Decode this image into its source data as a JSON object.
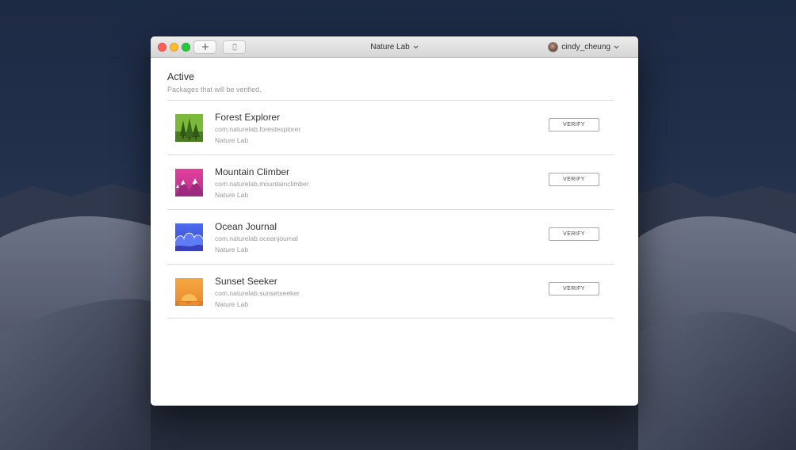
{
  "window": {
    "project": "Nature Lab",
    "user": "cindy_cheung"
  },
  "section": {
    "title": "Active",
    "subtitle": "Packages that will be verified."
  },
  "packages": [
    {
      "name": "Forest Explorer",
      "bundle_id": "com.naturelab.forestexplorer",
      "org": "Nature Lab",
      "action": "VERIFY",
      "icon": "forest-icon"
    },
    {
      "name": "Mountain Climber",
      "bundle_id": "com.naturelab.mountainclimber",
      "org": "Nature Lab",
      "action": "VERIFY",
      "icon": "mountain-icon"
    },
    {
      "name": "Ocean Journal",
      "bundle_id": "com.naturelab.oceanjournal",
      "org": "Nature Lab",
      "action": "VERIFY",
      "icon": "ocean-icon"
    },
    {
      "name": "Sunset Seeker",
      "bundle_id": "com.naturelab.sunsetseeker",
      "org": "Nature Lab",
      "action": "VERIFY",
      "icon": "sunset-icon"
    }
  ],
  "colors": {
    "close": "#fd5f57",
    "minimize": "#febc2e",
    "maximize": "#28c840",
    "forest": "#5c9c2e",
    "mountain": "#d03a9c",
    "ocean": "#4a5ee0",
    "sunset": "#f0a035"
  }
}
